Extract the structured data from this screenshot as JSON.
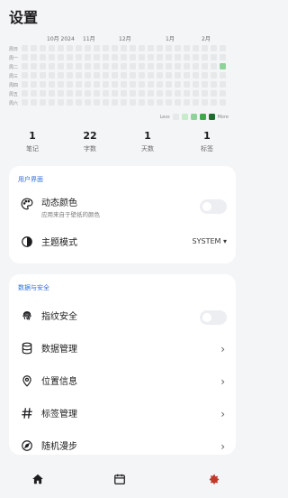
{
  "page_title": "设置",
  "heatmap": {
    "months": [
      "10月 2024",
      "11月",
      "12月",
      "1月",
      "2月"
    ],
    "weekdays": [
      "周日",
      "周一",
      "周二",
      "周三",
      "周四",
      "周五",
      "周六"
    ],
    "legend_less": "Less",
    "legend_more": "More",
    "colors": [
      "#e7e8ea",
      "#c7ecc9",
      "#8fd39a",
      "#3fa84f",
      "#1f6b2e"
    ],
    "active_day": {
      "week": 22,
      "weekday": "周二",
      "level": 2
    }
  },
  "stats": [
    {
      "value": "1",
      "label": "笔记"
    },
    {
      "value": "22",
      "label": "字数"
    },
    {
      "value": "1",
      "label": "天数"
    },
    {
      "value": "1",
      "label": "标签"
    }
  ],
  "ui_section": {
    "header": "用户界面",
    "dynamic_color_title": "动态颜色",
    "dynamic_color_subtitle": "应用来自于壁纸的颜色",
    "dynamic_color_enabled": false,
    "theme_mode_title": "主题模式",
    "theme_mode_value": "SYSTEM ▾"
  },
  "data_section": {
    "header": "数据与安全",
    "items": [
      {
        "title": "指纹安全",
        "icon": "fingerprint-icon",
        "control": "toggle",
        "enabled": false
      },
      {
        "title": "数据管理",
        "icon": "database-icon",
        "control": "chevron"
      },
      {
        "title": "位置信息",
        "icon": "location-pin-icon",
        "control": "chevron"
      },
      {
        "title": "标签管理",
        "icon": "hashtag-icon",
        "control": "chevron"
      },
      {
        "title": "随机漫步",
        "icon": "compass-icon",
        "control": "chevron"
      }
    ],
    "chevron": "›"
  },
  "bottom_nav": {
    "items": [
      "home-icon",
      "calendar-icon",
      "settings-gear-icon"
    ],
    "accent": "#c0392b"
  },
  "colors": {
    "accent_blue": "#2f6fde",
    "background": "#f4f5f7",
    "card": "#ffffff"
  }
}
